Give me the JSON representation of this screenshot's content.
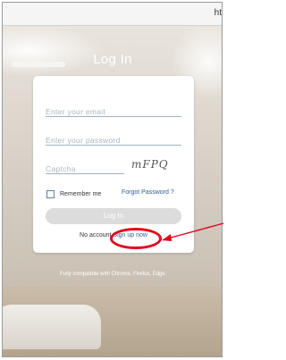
{
  "browser": {
    "url_fragment": "ht"
  },
  "login": {
    "title": "Log In",
    "email_placeholder": "Enter your email",
    "password_placeholder": "Enter your password",
    "captcha_placeholder": "Captcha",
    "captcha_code": "mFPQ",
    "remember_label": "Remember me",
    "forgot_label": "Forgot Password ?",
    "submit_label": "Log In",
    "no_account_label": "No account",
    "signup_label": "Sign up now",
    "compat_note": "Fully compatible with Chrome, Firefox, Edge"
  },
  "colors": {
    "highlight": "#e3001b",
    "link": "#2d5e95"
  }
}
